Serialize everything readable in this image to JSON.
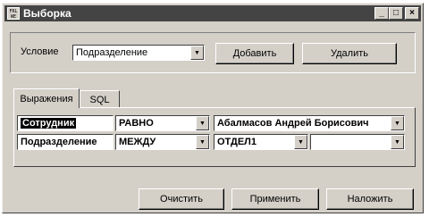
{
  "window": {
    "title": "Выборка",
    "icon_text": "FRL WE",
    "controls": {
      "minimize": "_",
      "maximize": "□",
      "close": "×"
    }
  },
  "condition": {
    "label": "Условие",
    "value": "Подразделение",
    "add_label": "Добавить",
    "delete_label": "Удалить"
  },
  "tabs": [
    {
      "label": "Выражения",
      "active": true
    },
    {
      "label": "SQL",
      "active": false
    }
  ],
  "rows": [
    {
      "field": "Сотрудник",
      "operator": "РАВНО",
      "value1": "Абалмасов Андрей Борисович",
      "value2": ""
    },
    {
      "field": "Подразделение",
      "operator": "МЕЖДУ",
      "value1": "ОТДЕЛ1",
      "value2": ""
    }
  ],
  "footer": {
    "clear_label": "Очистить",
    "apply_label": "Применить",
    "impose_label": "Наложить"
  }
}
